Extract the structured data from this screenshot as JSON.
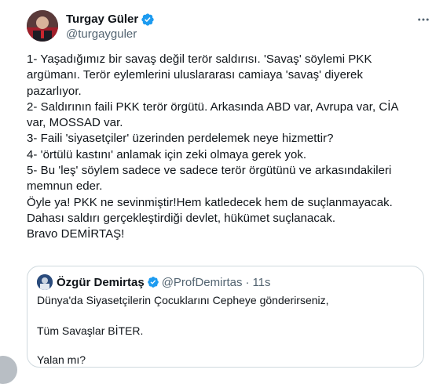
{
  "author": {
    "display_name": "Turgay Güler",
    "handle": "@turgayguler",
    "verified": true,
    "avatar_icon": "profile-photo-icon"
  },
  "tweet": {
    "lines": [
      "1- Yaşadığımız bir savaş değil terör saldırısı. 'Savaş' söylemi PKK",
      "argümanı. Terör eylemlerini uluslararası camiaya 'savaş' diyerek",
      "pazarlıyor.",
      "2- Saldırının faili PKK terör örgütü. Arkasında ABD var, Avrupa var, CİA",
      "var, MOSSAD var.",
      "3- Faili 'siyasetçiler' üzerinden perdelemek neye hizmettir?",
      "4- 'örtülü kastını' anlamak için zeki olmaya gerek yok.",
      "5- Bu 'leş' söylem sadece ve sadece terör örgütünü ve arkasındakileri",
      "memnun eder.",
      "Öyle ya!  PKK ne sevinmiştir!Hem katledecek hem de suçlanmayacak.",
      "Dahası saldırı gerçekleştirdiği devlet, hükümet suçlanacak.",
      "Bravo DEMİRTAŞ!"
    ]
  },
  "quoted": {
    "display_name": "Özgür Demirtaş",
    "handle": "@ProfDemirtas",
    "separator": "·",
    "time": "11s",
    "verified": true,
    "line1": "Dünya'da Siyasetçilerin Çocuklarını Cepheye gönderirseniz,",
    "line2": "Tüm Savaşlar BİTER.",
    "line3": "Yalan mı?"
  },
  "colors": {
    "verified_blue": "#1d9bf0",
    "secondary_text": "#536471",
    "border": "#cfd9de"
  }
}
